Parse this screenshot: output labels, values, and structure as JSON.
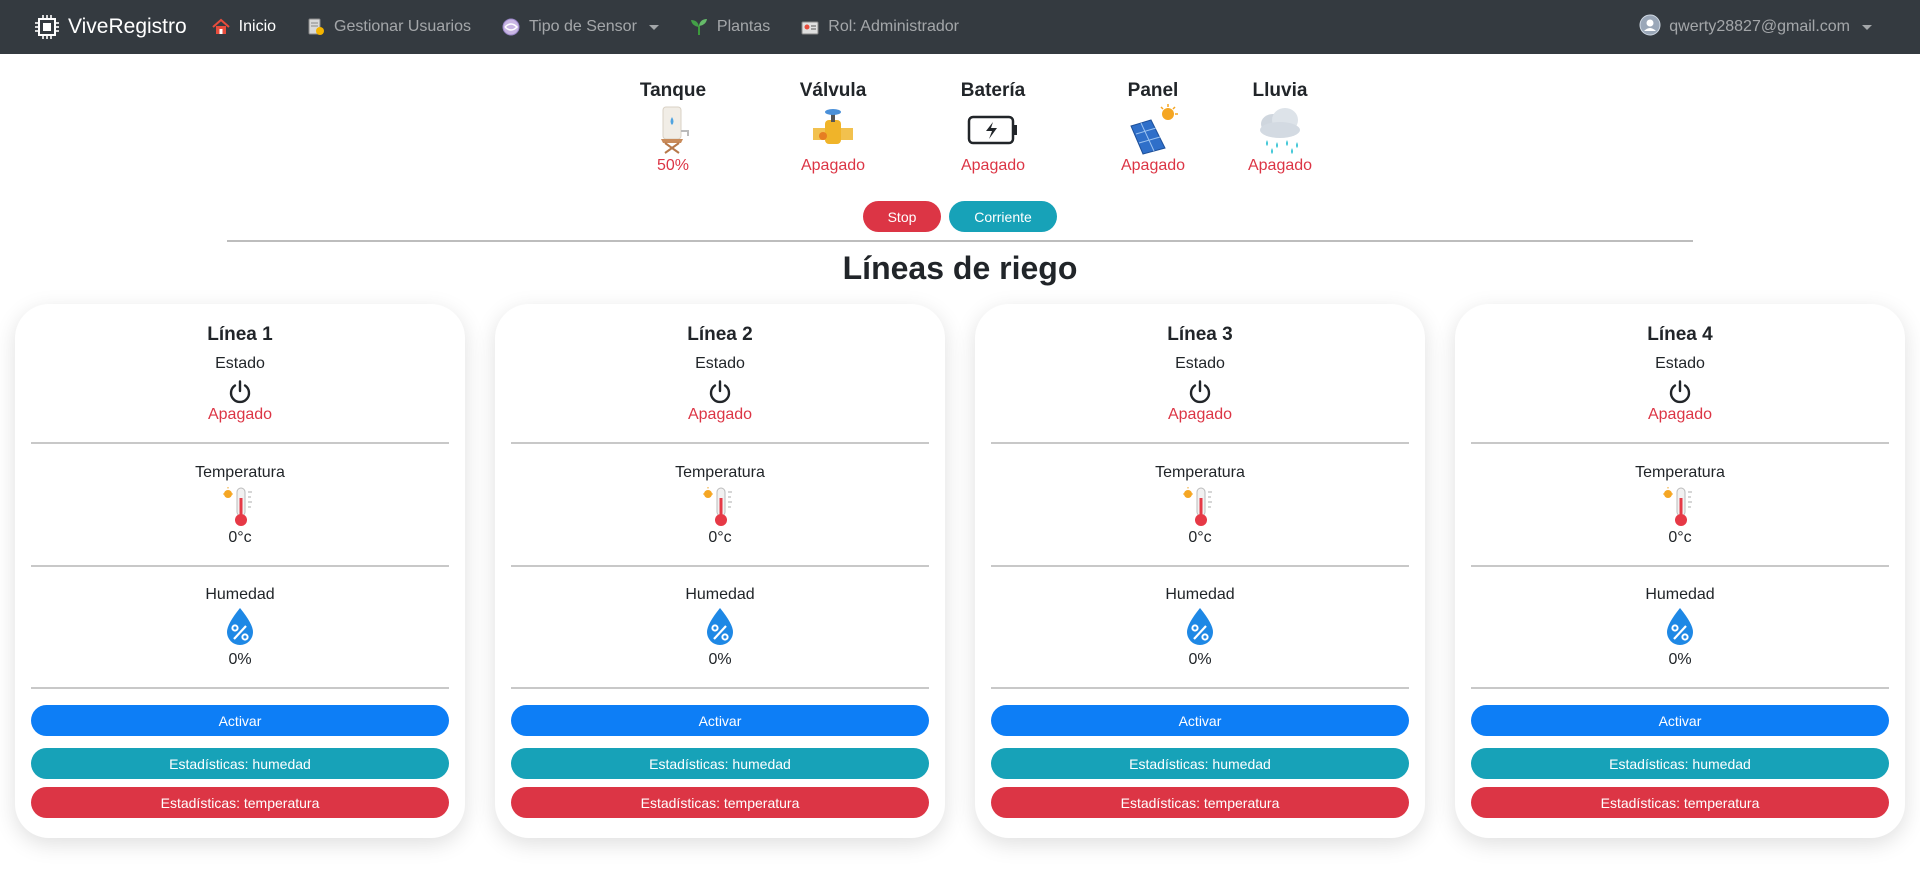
{
  "navbar": {
    "brand": "ViveRegistro",
    "items": [
      {
        "label": "Inicio",
        "icon": "home-icon"
      },
      {
        "label": "Gestionar Usuarios",
        "icon": "user-management-icon"
      },
      {
        "label": "Tipo de Sensor",
        "icon": "sensor-icon"
      },
      {
        "label": "Plantas",
        "icon": "plant-icon"
      },
      {
        "label": "Rol: Administrador",
        "icon": "role-icon"
      }
    ],
    "user_email": "qwerty28827@gmail.com"
  },
  "devices": [
    {
      "title": "Tanque",
      "status": "50%",
      "icon": "tank-icon"
    },
    {
      "title": "Válvula",
      "status": "Apagado",
      "icon": "valve-icon"
    },
    {
      "title": "Batería",
      "status": "Apagado",
      "icon": "battery-icon"
    },
    {
      "title": "Panel",
      "status": "Apagado",
      "icon": "solar-panel-icon"
    },
    {
      "title": "Lluvia",
      "status": "Apagado",
      "icon": "rain-icon"
    }
  ],
  "controls": {
    "stop": "Stop",
    "corriente": "Corriente"
  },
  "section_title": "Líneas de riego",
  "lines": [
    {
      "title": "Línea 1",
      "estado_label": "Estado",
      "estado": "Apagado",
      "temp_label": "Temperatura",
      "temp": "0°c",
      "hum_label": "Humedad",
      "hum": "0%",
      "activar": "Activar",
      "stats_hum": "Estadísticas: humedad",
      "stats_temp": "Estadísticas: temperatura"
    },
    {
      "title": "Línea 2",
      "estado_label": "Estado",
      "estado": "Apagado",
      "temp_label": "Temperatura",
      "temp": "0°c",
      "hum_label": "Humedad",
      "hum": "0%",
      "activar": "Activar",
      "stats_hum": "Estadísticas: humedad",
      "stats_temp": "Estadísticas: temperatura"
    },
    {
      "title": "Línea 3",
      "estado_label": "Estado",
      "estado": "Apagado",
      "temp_label": "Temperatura",
      "temp": "0°c",
      "hum_label": "Humedad",
      "hum": "0%",
      "activar": "Activar",
      "stats_hum": "Estadísticas: humedad",
      "stats_temp": "Estadísticas: temperatura"
    },
    {
      "title": "Línea 4",
      "estado_label": "Estado",
      "estado": "Apagado",
      "temp_label": "Temperatura",
      "temp": "0°c",
      "hum_label": "Humedad",
      "hum": "0%",
      "activar": "Activar",
      "stats_hum": "Estadísticas: humedad",
      "stats_temp": "Estadísticas: temperatura"
    }
  ],
  "colors": {
    "navbar": "#343a40",
    "danger": "#dc3545",
    "info": "#17a2b8",
    "primary": "#0d7ef6"
  }
}
